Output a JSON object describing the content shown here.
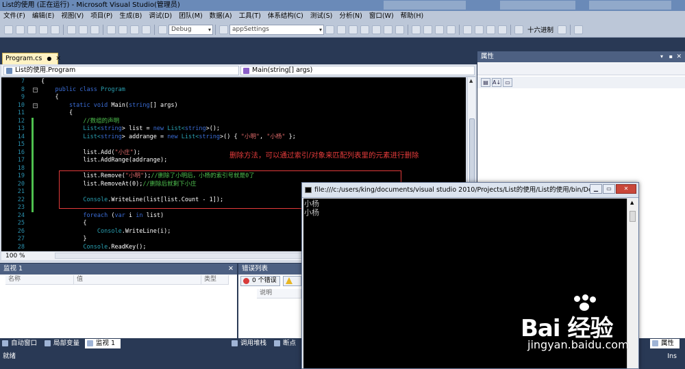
{
  "window": {
    "title": "List的使用 (正在运行) - Microsoft Visual Studio(管理员)"
  },
  "menu": [
    "文件(F)",
    "编辑(E)",
    "视图(V)",
    "项目(P)",
    "生成(B)",
    "调试(D)",
    "团队(M)",
    "数据(A)",
    "工具(T)",
    "体系结构(C)",
    "测试(S)",
    "分析(N)",
    "窗口(W)",
    "帮助(H)"
  ],
  "toolbar": {
    "config": "Debug",
    "target": "appSettings",
    "hex_label": "十六进制"
  },
  "editor": {
    "tab_label": "Program.cs",
    "nav_left": "List的使用.Program",
    "nav_right": "Main(string[] args)",
    "zoom": "100 %",
    "lines": [
      {
        "n": "7",
        "segs": [
          {
            "t": "{",
            "c": ""
          }
        ]
      },
      {
        "n": "8",
        "segs": [
          {
            "t": "    public class ",
            "c": "kw"
          },
          {
            "t": "Program",
            "c": "ty"
          }
        ]
      },
      {
        "n": "9",
        "segs": [
          {
            "t": "    {",
            "c": ""
          }
        ]
      },
      {
        "n": "10",
        "segs": [
          {
            "t": "        static void ",
            "c": "kw"
          },
          {
            "t": "Main(",
            "c": ""
          },
          {
            "t": "string",
            "c": "kw"
          },
          {
            "t": "[] args)",
            "c": ""
          }
        ]
      },
      {
        "n": "11",
        "segs": [
          {
            "t": "        {",
            "c": ""
          }
        ]
      },
      {
        "n": "12",
        "segs": [
          {
            "t": "            //数组的声明",
            "c": "cm"
          }
        ]
      },
      {
        "n": "13",
        "segs": [
          {
            "t": "            List<",
            "c": "ty"
          },
          {
            "t": "string",
            "c": "kw"
          },
          {
            "t": "> list = ",
            "c": ""
          },
          {
            "t": "new ",
            "c": "kw"
          },
          {
            "t": "List<",
            "c": "ty"
          },
          {
            "t": "string",
            "c": "kw"
          },
          {
            "t": ">();",
            "c": ""
          }
        ]
      },
      {
        "n": "14",
        "segs": [
          {
            "t": "            List<",
            "c": "ty"
          },
          {
            "t": "string",
            "c": "kw"
          },
          {
            "t": "> addrange = ",
            "c": ""
          },
          {
            "t": "new ",
            "c": "kw"
          },
          {
            "t": "List<",
            "c": "ty"
          },
          {
            "t": "string",
            "c": "kw"
          },
          {
            "t": ">() { ",
            "c": ""
          },
          {
            "t": "\"小明\"",
            "c": "str"
          },
          {
            "t": ", ",
            "c": ""
          },
          {
            "t": "\"小杨\"",
            "c": "str"
          },
          {
            "t": " };",
            "c": ""
          }
        ]
      },
      {
        "n": "15",
        "segs": [
          {
            "t": "",
            "c": ""
          }
        ]
      },
      {
        "n": "16",
        "segs": [
          {
            "t": "            list.Add(",
            "c": ""
          },
          {
            "t": "\"小庄\"",
            "c": "str"
          },
          {
            "t": ");",
            "c": ""
          }
        ]
      },
      {
        "n": "17",
        "segs": [
          {
            "t": "            list.AddRange(addrange);",
            "c": ""
          }
        ]
      },
      {
        "n": "18",
        "segs": [
          {
            "t": "",
            "c": ""
          }
        ]
      },
      {
        "n": "19",
        "segs": [
          {
            "t": "            list.Remove(",
            "c": ""
          },
          {
            "t": "\"小明\"",
            "c": "str"
          },
          {
            "t": ");",
            "c": ""
          },
          {
            "t": "//删除了小明后，小杨的索引号就是0了",
            "c": "cm"
          }
        ]
      },
      {
        "n": "20",
        "segs": [
          {
            "t": "            list.RemoveAt(0);",
            "c": ""
          },
          {
            "t": "//删除后就剩下小庄",
            "c": "cm"
          }
        ]
      },
      {
        "n": "21",
        "segs": [
          {
            "t": "",
            "c": ""
          }
        ]
      },
      {
        "n": "22",
        "segs": [
          {
            "t": "            Console",
            "c": "ty"
          },
          {
            "t": ".WriteLine(list[list.Count - 1]);",
            "c": ""
          }
        ]
      },
      {
        "n": "23",
        "segs": [
          {
            "t": "",
            "c": ""
          }
        ]
      },
      {
        "n": "24",
        "segs": [
          {
            "t": "            foreach ",
            "c": "kw"
          },
          {
            "t": "(",
            "c": ""
          },
          {
            "t": "var ",
            "c": "kw"
          },
          {
            "t": "i ",
            "c": ""
          },
          {
            "t": "in ",
            "c": "kw"
          },
          {
            "t": "list)",
            "c": ""
          }
        ]
      },
      {
        "n": "25",
        "segs": [
          {
            "t": "            {",
            "c": ""
          }
        ]
      },
      {
        "n": "26",
        "segs": [
          {
            "t": "                Console",
            "c": "ty"
          },
          {
            "t": ".WriteLine(i);",
            "c": ""
          }
        ]
      },
      {
        "n": "27",
        "segs": [
          {
            "t": "            }",
            "c": ""
          }
        ]
      },
      {
        "n": "28",
        "segs": [
          {
            "t": "            Console",
            "c": "ty"
          },
          {
            "t": ".ReadKey();",
            "c": ""
          }
        ]
      }
    ]
  },
  "annotation": "删除方法，可以通过索引/对象来匹配列表里的元素进行删除",
  "properties": {
    "title": "属性"
  },
  "watch": {
    "title": "监视 1",
    "cols": [
      "名称",
      "值",
      "类型"
    ]
  },
  "errors": {
    "title": "错误列表",
    "errors_btn": "0 个错误",
    "col": "说明"
  },
  "bottom_tabs": [
    "自动窗口",
    "局部变量",
    "监视 1"
  ],
  "bottom_tabs2": [
    "调用堆栈",
    "断点"
  ],
  "right_tab": "属性",
  "status": {
    "left": "就绪",
    "right": "Ins"
  },
  "console": {
    "title": "file:///c:/users/king/documents/visual studio 2010/Projects/List的使用/List的使用/bin/Debu...",
    "output": [
      "小杨",
      "小杨"
    ]
  },
  "watermark": {
    "brand": "Bai  经验",
    "url": "jingyan.baidu.com"
  }
}
